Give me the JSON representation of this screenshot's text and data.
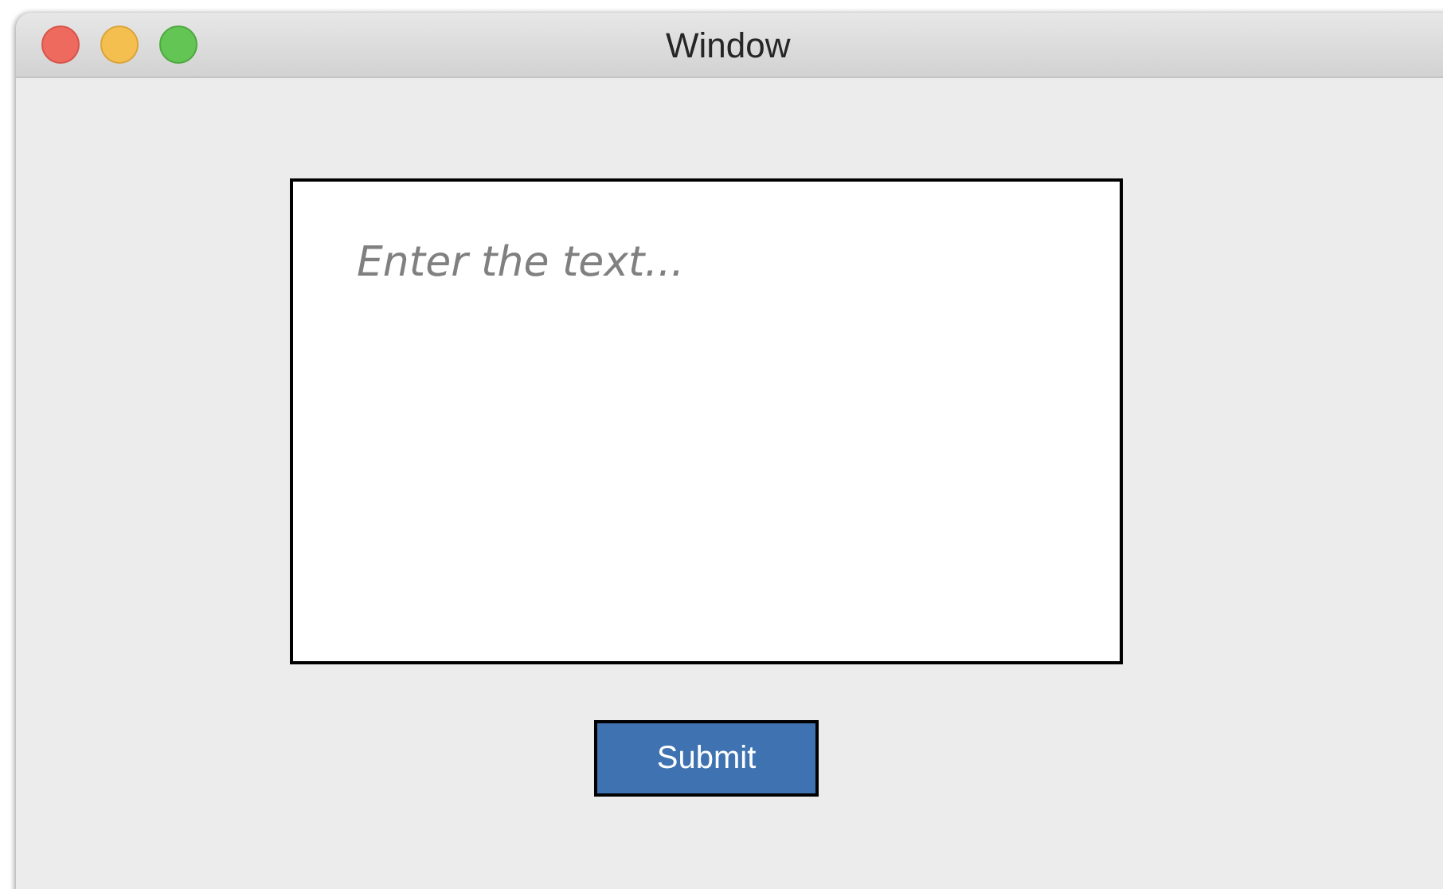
{
  "window": {
    "title": "Window"
  },
  "text_area": {
    "placeholder": "Enter the text..."
  },
  "submit_button": {
    "label": "Submit"
  }
}
